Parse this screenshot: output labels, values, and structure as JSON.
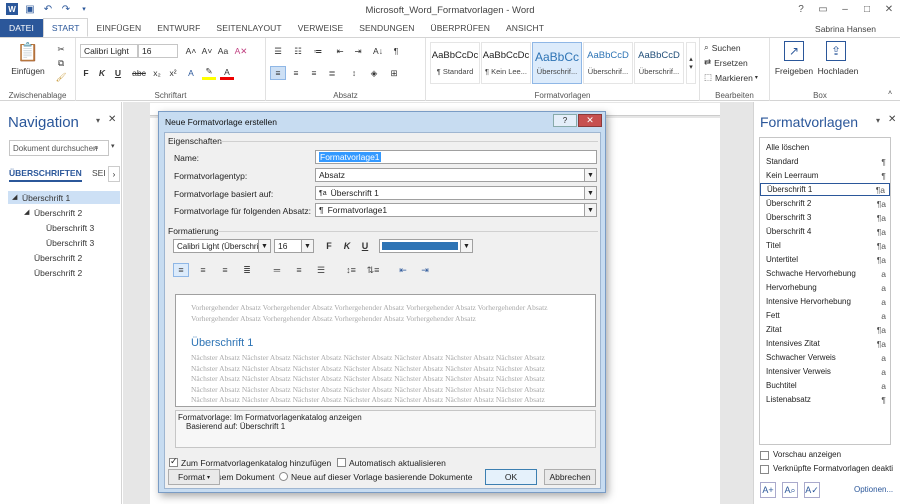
{
  "window": {
    "title": "Microsoft_Word_Formatvorlagen - Word",
    "user": "Sabrina Hansen",
    "accent": "#2b579a"
  },
  "tabs": [
    "DATEI",
    "START",
    "EINFÜGEN",
    "ENTWURF",
    "SEITENLAYOUT",
    "VERWEISE",
    "SENDUNGEN",
    "ÜBERPRÜFEN",
    "ANSICHT"
  ],
  "ribbon": {
    "clipboard": {
      "paste_label": "Einfügen",
      "group": "Zwischenablage"
    },
    "font": {
      "font_name": "Calibri Light",
      "font_size": "16",
      "group": "Schriftart"
    },
    "paragraph": {
      "group": "Absatz"
    },
    "styles": {
      "group": "Formatvorlagen",
      "tiles": [
        {
          "preview": "AaBbCcDc",
          "label": "¶ Standard"
        },
        {
          "preview": "AaBbCcDc",
          "label": "¶ Kein Lee..."
        },
        {
          "preview": "AaBbCc",
          "label": "Überschrif..."
        },
        {
          "preview": "AaBbCcD",
          "label": "Überschrif..."
        },
        {
          "preview": "AaBbCcD",
          "label": "Überschrif..."
        }
      ]
    },
    "editing": {
      "search": "Suchen",
      "replace": "Ersetzen",
      "select": "Markieren",
      "group": "Bearbeiten"
    },
    "box": {
      "share": "Freigeben",
      "folders": "Hochladen",
      "group": "Box"
    }
  },
  "navigation": {
    "title": "Navigation",
    "search_placeholder": "Dokument durchsuchen",
    "tab_headings": "ÜBERSCHRIFTEN",
    "tab_pages": "SEI",
    "items": [
      {
        "label": "Überschrift 1",
        "level": 1
      },
      {
        "label": "Überschrift 2",
        "level": 2
      },
      {
        "label": "Überschrift 3",
        "level": 3
      },
      {
        "label": "Überschrift 3",
        "level": 3
      },
      {
        "label": "Überschrift 2",
        "level": 2
      },
      {
        "label": "Überschrift 2",
        "level": 2
      }
    ]
  },
  "styles_pane": {
    "title": "Formatvorlagen",
    "items": [
      {
        "label": "Alle löschen",
        "sym": ""
      },
      {
        "label": "Standard",
        "sym": "¶"
      },
      {
        "label": "Kein Leerraum",
        "sym": "¶"
      },
      {
        "label": "Überschrift 1",
        "sym": "¶a"
      },
      {
        "label": "Überschrift 2",
        "sym": "¶a"
      },
      {
        "label": "Überschrift 3",
        "sym": "¶a"
      },
      {
        "label": "Überschrift 4",
        "sym": "¶a"
      },
      {
        "label": "Titel",
        "sym": "¶a"
      },
      {
        "label": "Untertitel",
        "sym": "¶a"
      },
      {
        "label": "Schwache Hervorhebung",
        "sym": "a"
      },
      {
        "label": "Hervorhebung",
        "sym": "a"
      },
      {
        "label": "Intensive Hervorhebung",
        "sym": "a"
      },
      {
        "label": "Fett",
        "sym": "a"
      },
      {
        "label": "Zitat",
        "sym": "¶a"
      },
      {
        "label": "Intensives Zitat",
        "sym": "¶a"
      },
      {
        "label": "Schwacher Verweis",
        "sym": "a"
      },
      {
        "label": "Intensiver Verweis",
        "sym": "a"
      },
      {
        "label": "Buchtitel",
        "sym": "a"
      },
      {
        "label": "Listenabsatz",
        "sym": "¶"
      }
    ],
    "selected_index": 3,
    "preview_label": "Vorschau anzeigen",
    "linked_label": "Verknüpfte Formatvorlagen deakti",
    "options": "Optionen..."
  },
  "dialog": {
    "title": "Neue Formatvorlage erstellen",
    "help": "?",
    "properties_label": "Eigenschaften",
    "name_label": "Name:",
    "name_value": "Formatvorlage1",
    "type_label": "Formatvorlagentyp:",
    "type_value": "Absatz",
    "based_label": "Formatvorlage basiert auf:",
    "based_value": "Überschrift 1",
    "next_label": "Formatvorlage für folgenden Absatz:",
    "next_value": "Formatvorlage1",
    "formatting_label": "Formatierung",
    "font": "Calibri Light (Überschrift)",
    "size": "16",
    "color": "#2e74b5",
    "preview_prev": "Vorhergehender Absatz Vorhergehender Absatz Vorhergehender Absatz Vorhergehender Absatz Vorhergehender Absatz Vorhergehender Absatz Vorhergehender Absatz Vorhergehender Absatz Vorhergehender Absatz",
    "preview_heading": "Überschrift 1",
    "preview_next": "Nächster Absatz Nächster Absatz Nächster Absatz Nächster Absatz Nächster Absatz Nächster Absatz Nächster Absatz Nächster Absatz Nächster Absatz Nächster Absatz Nächster Absatz Nächster Absatz Nächster Absatz Nächster Absatz Nächster Absatz Nächster Absatz Nächster Absatz Nächster Absatz Nächster Absatz Nächster Absatz Nächster Absatz Nächster Absatz Nächster Absatz Nächster Absatz Nächster Absatz Nächster Absatz Nächster Absatz Nächster Absatz Nächster Absatz Nächster Absatz Nächster Absatz Nächster Absatz Nächster Absatz Nächster Absatz Nächster Absatz Nächster Absatz Nächster Absatz Nächster Absatz Nächster Absatz Nächster Absatz Nächster Absatz Nächster Absatz",
    "desc_line1": "Formatvorlage: Im Formatvorlagenkatalog anzeigen",
    "desc_line2": "Basierend auf: Überschrift 1",
    "add_to_gallery": "Zum Formatvorlagenkatalog hinzufügen",
    "auto_update": "Automatisch aktualisieren",
    "only_doc": "Nur in diesem Dokument",
    "new_docs": "Neue auf dieser Vorlage basierende Dokumente",
    "format_btn": "Format",
    "ok": "OK",
    "cancel": "Abbrechen"
  }
}
